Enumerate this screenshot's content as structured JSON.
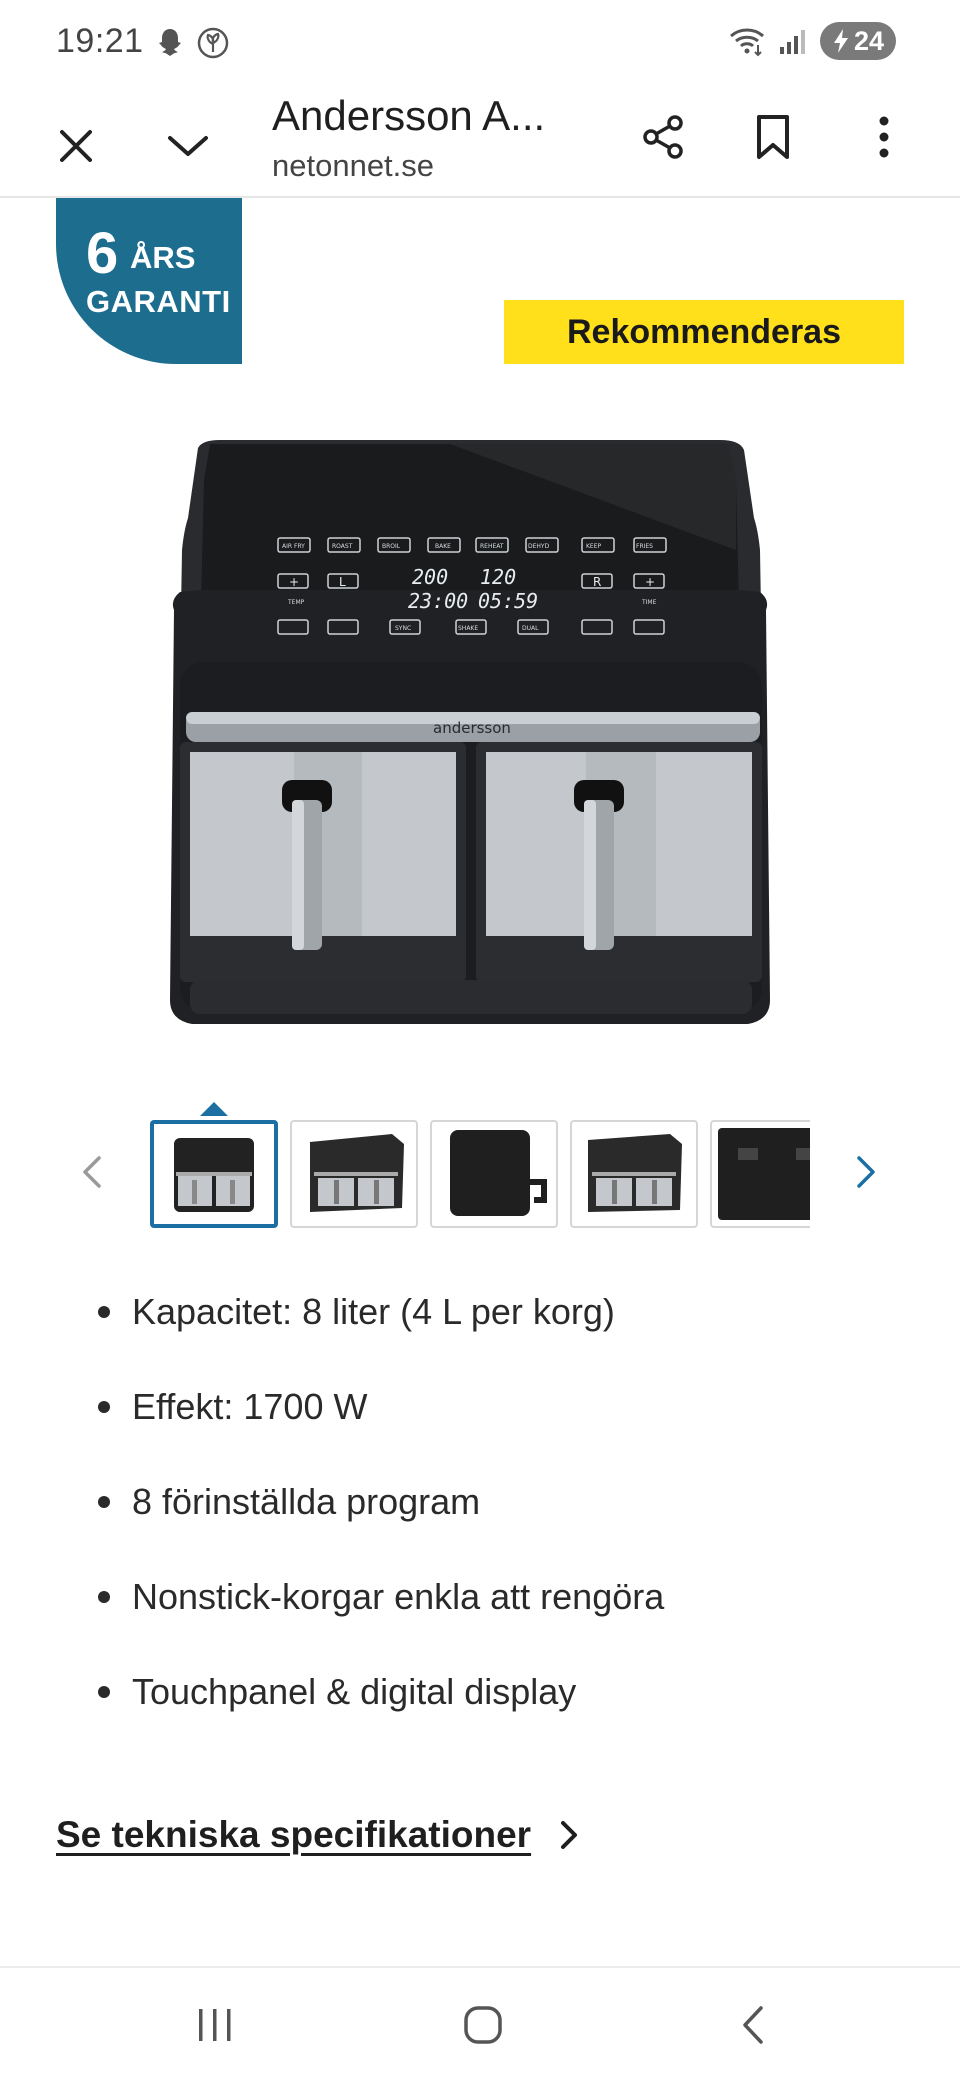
{
  "status": {
    "time": "19:21",
    "battery": "24"
  },
  "browser": {
    "title": "Andersson A...",
    "domain": "netonnet.se"
  },
  "product": {
    "warranty_number": "6",
    "warranty_years": "ÅRS",
    "warranty_word": "GARANTI",
    "badge": "Rekommenderas",
    "brand": "andersson",
    "display_line1": "200 °  120 °",
    "display_line2": "23:00  05:59",
    "panel_buttons": [
      "AIR FRY",
      "ROAST",
      "BROIL",
      "BAKE",
      "REHEAT",
      "DEHYDRATE",
      "KEEP WARM",
      "FRENCH FRIES"
    ],
    "panel_labels": {
      "temp": "TEMP",
      "time": "TIME",
      "sync": "SYNC",
      "shake": "SHAKE",
      "dual": "DUAL COOK",
      "l": "L",
      "r": "R"
    }
  },
  "gallery": {
    "thumb_count": 5,
    "active_index": 0
  },
  "features": [
    "Kapacitet: 8 liter (4 L per korg)",
    "Effekt: 1700 W",
    "8 förinställda program",
    "Nonstick-korgar enkla att rengöra",
    "Touchpanel & digital display"
  ],
  "spec_link": "Se tekniska specifikationer",
  "colors": {
    "accent": "#1c6fa3",
    "badge_yellow": "#ffe01a",
    "warranty_blue": "#1d6d8f"
  }
}
